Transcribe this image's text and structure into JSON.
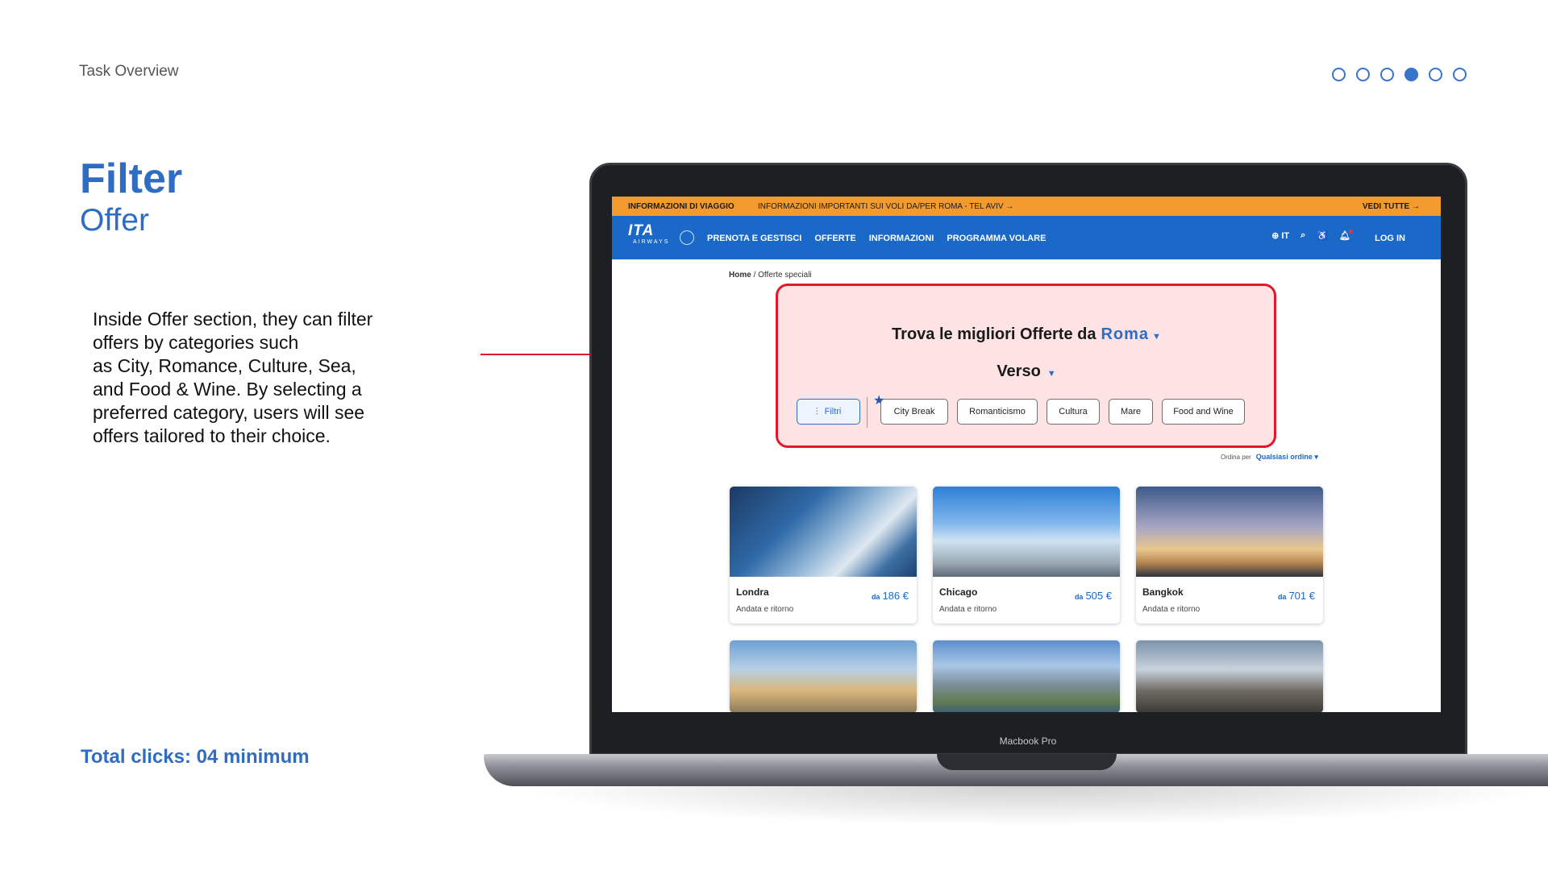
{
  "slide": {
    "header": "Task Overview",
    "pager": {
      "total": 6,
      "active_index": 3
    },
    "title": "Filter",
    "subtitle": "Offer",
    "description": "Inside Offer section, they can filter\noffers by categories such\nas City, Romance, Culture, Sea,\nand Food & Wine. By selecting a\npreferred category, users will see\noffers tailored to their choice.",
    "total_clicks": "Total clicks:  04 minimum",
    "device_label": "Macbook Pro",
    "accent_color": "#2f6cc4",
    "highlight_color": "#e3162b"
  },
  "site": {
    "infobar": {
      "label": "INFORMAZIONI DI VIAGGIO",
      "message": "INFORMAZIONI IMPORTANTI SUI VOLI DA/PER ROMA - TEL AVIV",
      "see_all": "VEDI TUTTE",
      "color": "#f29a2e"
    },
    "nav": {
      "logo_text": "ITA",
      "logo_sub": "AIRWAYS",
      "links": [
        "PRENOTA E GESTISCI",
        "OFFERTE",
        "INFORMAZIONI",
        "PROGRAMMA VOLARE"
      ],
      "language": "IT",
      "login": "LOG IN",
      "color": "#1a68c8"
    },
    "breadcrumb": {
      "home": "Home",
      "current": " / Offerte speciali"
    },
    "search": {
      "prompt": "Trova le migliori Offerte da",
      "origin": "Roma",
      "destination_prompt": "Verso"
    },
    "filters": {
      "main": "Filtri",
      "categories": [
        "City Break",
        "Romanticismo",
        "Cultura",
        "Mare",
        "Food and Wine"
      ]
    },
    "sort": {
      "label": "Ordina per",
      "value": "Qualsiasi ordine"
    },
    "offers": [
      {
        "city": "Londra",
        "trip": "Andata e ritorno",
        "price_prefix": "da",
        "price": "186 €"
      },
      {
        "city": "Chicago",
        "trip": "Andata e ritorno",
        "price_prefix": "da",
        "price": "505 €"
      },
      {
        "city": "Bangkok",
        "trip": "Andata e ritorno",
        "price_prefix": "da",
        "price": "701 €"
      }
    ]
  }
}
